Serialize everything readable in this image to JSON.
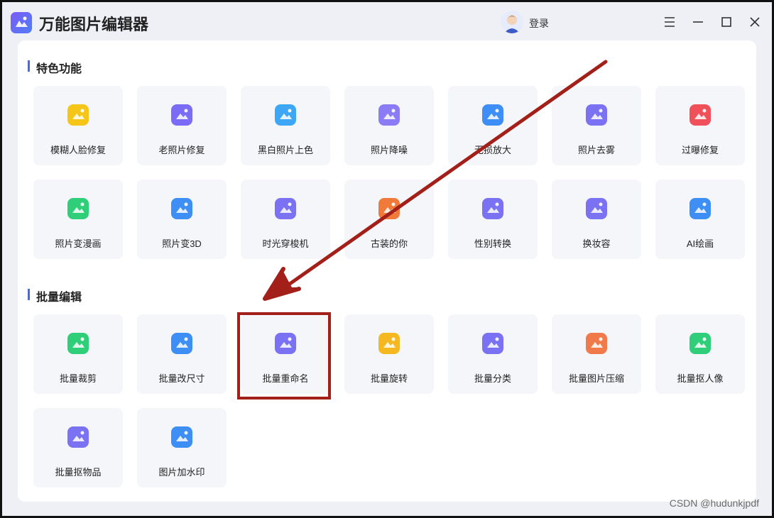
{
  "app": {
    "title": "万能图片编辑器",
    "login_label": "登录"
  },
  "sections": {
    "featured": {
      "title": "特色功能",
      "items": [
        {
          "label": "模糊人脸修复",
          "icon": "face-blur-repair-icon",
          "color": "#f5c518"
        },
        {
          "label": "老照片修复",
          "icon": "old-photo-repair-icon",
          "color": "#7a6cf5"
        },
        {
          "label": "黑白照片上色",
          "icon": "colorize-palette-icon",
          "color": "#3ea7f5"
        },
        {
          "label": "照片降噪",
          "icon": "denoise-icon",
          "color": "#8b7cf6"
        },
        {
          "label": "无损放大",
          "icon": "upscale-icon",
          "color": "#3d8ef5"
        },
        {
          "label": "照片去雾",
          "icon": "defog-icon",
          "color": "#7b72f3"
        },
        {
          "label": "过曝修复",
          "icon": "overexposure-repair-icon",
          "color": "#f0505a"
        },
        {
          "label": "照片变漫画",
          "icon": "cartoon-bear-icon",
          "color": "#2fcf7a"
        },
        {
          "label": "照片变3D",
          "icon": "cube-3d-icon",
          "color": "#3d8ef5"
        },
        {
          "label": "时光穿梭机",
          "icon": "time-machine-icon",
          "color": "#7b72f3"
        },
        {
          "label": "古装的你",
          "icon": "ancient-costume-icon",
          "color": "#f07a3a"
        },
        {
          "label": "性别转换",
          "icon": "gender-swap-icon",
          "color": "#7b72f3"
        },
        {
          "label": "换妆容",
          "icon": "makeup-face-icon",
          "color": "#7b72f3"
        },
        {
          "label": "AI绘画",
          "icon": "ai-painting-icon",
          "color": "#3d8ef5"
        }
      ]
    },
    "batch": {
      "title": "批量编辑",
      "items": [
        {
          "label": "批量裁剪",
          "icon": "batch-crop-icon",
          "color": "#2fcf7a"
        },
        {
          "label": "批量改尺寸",
          "icon": "batch-resize-icon",
          "color": "#3d8ef5"
        },
        {
          "label": "批量重命名",
          "icon": "batch-rename-icon",
          "color": "#7b72f3"
        },
        {
          "label": "批量旋转",
          "icon": "batch-rotate-icon",
          "color": "#f5b820"
        },
        {
          "label": "批量分类",
          "icon": "batch-classify-icon",
          "color": "#7b72f3"
        },
        {
          "label": "批量图片压缩",
          "icon": "batch-compress-icon",
          "color": "#f07a4a"
        },
        {
          "label": "批量抠人像",
          "icon": "batch-portrait-cutout-icon",
          "color": "#2fcf7a"
        },
        {
          "label": "批量抠物品",
          "icon": "batch-object-cutout-icon",
          "color": "#7b72f3"
        },
        {
          "label": "图片加水印",
          "icon": "add-watermark-icon",
          "color": "#3d8ef5"
        }
      ]
    }
  },
  "watermark": "CSDN @hudunkjpdf"
}
